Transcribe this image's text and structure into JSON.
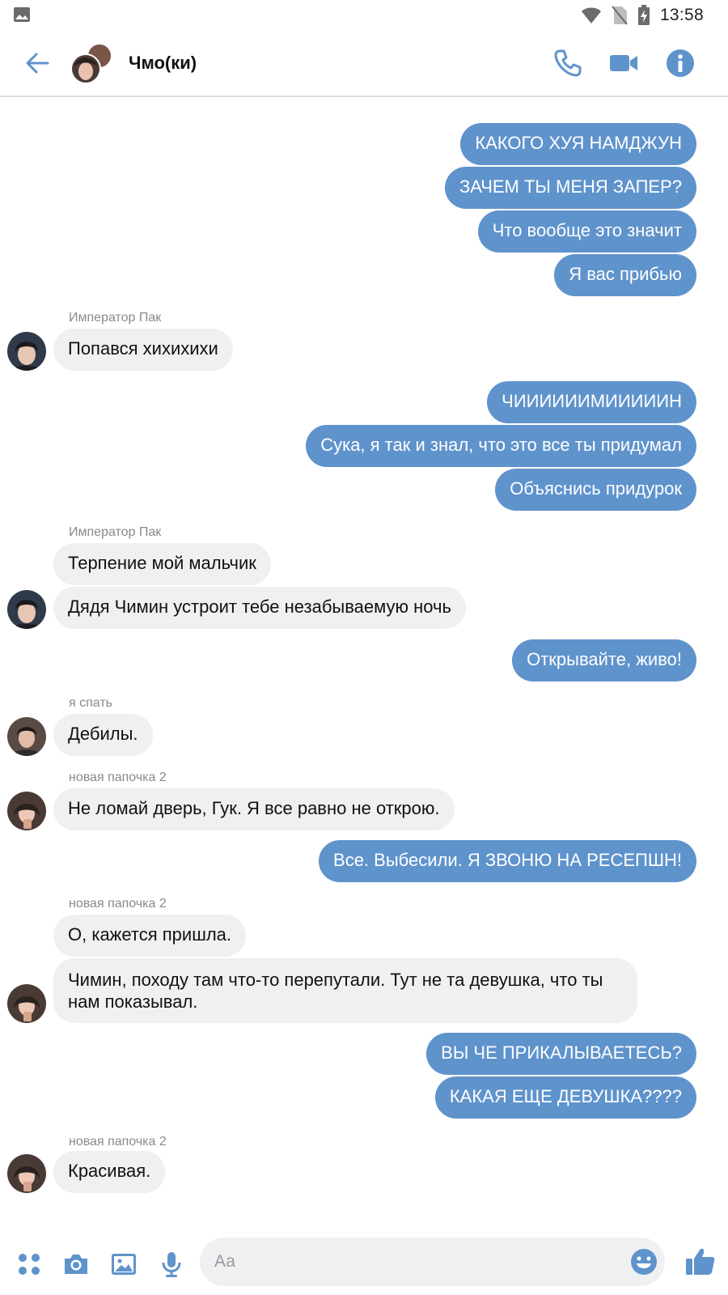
{
  "status_bar": {
    "time": "13:58"
  },
  "header": {
    "title": "Чмо(ки)"
  },
  "messages": [
    {
      "text": "КАКОГО ХУЯ НАМДЖУН"
    },
    {
      "text": "ЗАЧЕМ ТЫ МЕНЯ ЗАПЕР?"
    },
    {
      "text": "Что вообще это значит"
    },
    {
      "text": "Я вас прибью"
    },
    {
      "sender": "Император Пак",
      "text": "Попався хихихихи"
    },
    {
      "text": "ЧИИИИИИМИИИИИН"
    },
    {
      "text": "Сука, я так и знал, что это все ты придумал"
    },
    {
      "text": "Объяснись придурок"
    },
    {
      "sender": "Император Пак",
      "text": "Терпение мой мальчик"
    },
    {
      "text": "Дядя Чимин устроит тебе незабываемую ночь"
    },
    {
      "text": "Открывайте, живо!"
    },
    {
      "sender": "я спать",
      "text": "Дебилы."
    },
    {
      "sender": "новая папочка 2",
      "text": "Не ломай дверь, Гук. Я все равно не открою."
    },
    {
      "text": "Все. Выбесили. Я ЗВОНЮ НА РЕСЕПШН!"
    },
    {
      "sender": "новая папочка 2",
      "text": "О, кажется пришла."
    },
    {
      "text": "Чимин, походу там что-то перепутали. Тут не та девушка, что ты нам показывал."
    },
    {
      "text": "ВЫ ЧЕ ПРИКАЛЫВАЕТЕСЬ?"
    },
    {
      "text": "КАКАЯ ЕЩЕ ДЕВУШКА????"
    },
    {
      "sender": "новая папочка 2",
      "text": "Красивая."
    }
  ],
  "composer": {
    "placeholder": "Аа"
  },
  "colors": {
    "accent": "#5f93cc",
    "incoming_bubble": "#f0f0f3",
    "icon": "#5f93cc"
  },
  "icons": {
    "header": [
      "back-arrow-icon",
      "phone-icon",
      "video-camera-icon",
      "info-icon"
    ],
    "composer": [
      "grid-dots-icon",
      "camera-icon",
      "image-icon",
      "microphone-icon",
      "emoji-icon",
      "thumbs-up-icon"
    ]
  }
}
